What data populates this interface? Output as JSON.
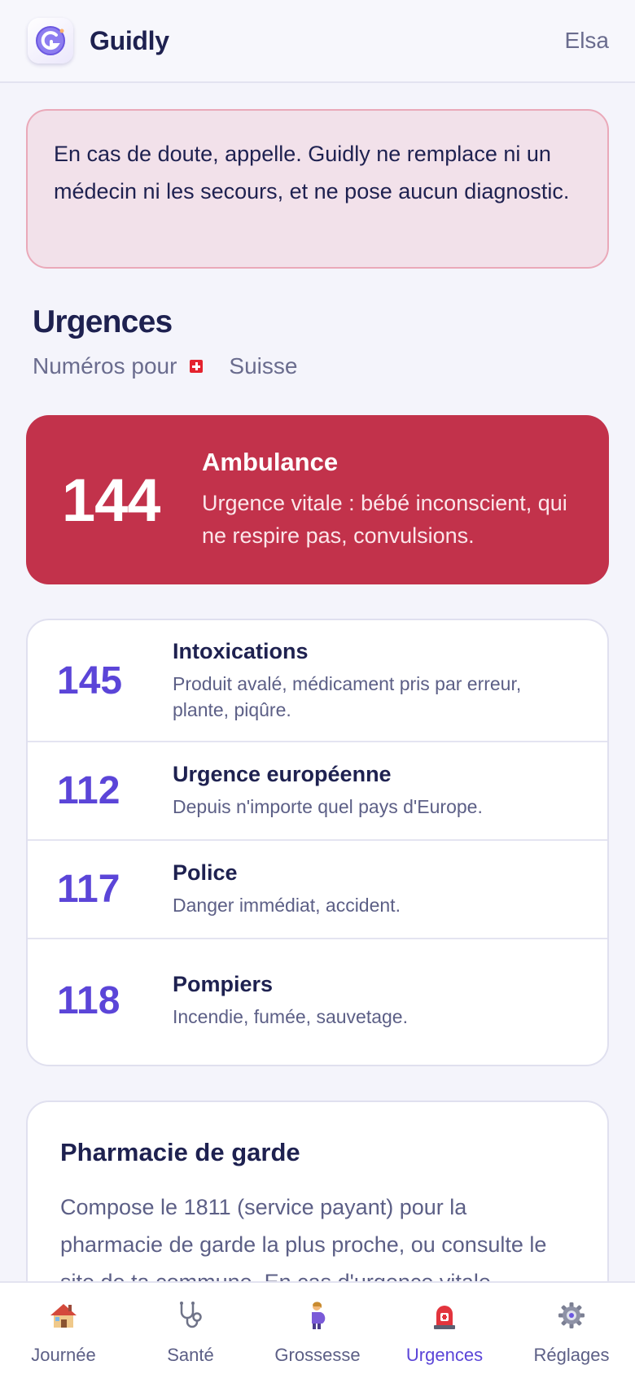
{
  "header": {
    "app_name": "Guidly",
    "user_name": "Elsa"
  },
  "warning": {
    "text": "En cas de doute, appelle. Guidly ne remplace ni un médecin ni les secours, et ne pose aucun diagnostic."
  },
  "section": {
    "title": "Urgences",
    "subtitle_prefix": "Numéros pour",
    "country": "Suisse"
  },
  "primary": {
    "number": "144",
    "title": "Ambulance",
    "description": "Urgence vitale : bébé inconscient, qui ne respire pas, convulsions."
  },
  "numbers": [
    {
      "number": "145",
      "title": "Intoxications",
      "description": "Produit avalé, médicament pris par erreur, plante, piqûre."
    },
    {
      "number": "112",
      "title": "Urgence européenne",
      "description": "Depuis n'importe quel pays d'Europe."
    },
    {
      "number": "117",
      "title": "Police",
      "description": "Danger immédiat, accident."
    },
    {
      "number": "118",
      "title": "Pompiers",
      "description": "Incendie, fumée, sauvetage."
    }
  ],
  "pharmacy": {
    "title": "Pharmacie de garde",
    "text": "Compose le 1811 (service payant) pour la pharmacie de garde la plus proche, ou consulte le site de ta commune. En cas d'urgence vitale"
  },
  "tabs": [
    {
      "label": "Journée",
      "icon": "house-icon"
    },
    {
      "label": "Santé",
      "icon": "stethoscope-icon"
    },
    {
      "label": "Grossesse",
      "icon": "pregnant-woman-icon"
    },
    {
      "label": "Urgences",
      "icon": "siren-icon",
      "active": true
    },
    {
      "label": "Réglages",
      "icon": "gear-icon"
    }
  ],
  "colors": {
    "accent": "#5b45d8",
    "emergency": "#c2324b",
    "warning_bg": "#f2e1ea",
    "warning_border": "#eaa9b9",
    "text_primary": "#1e2150",
    "text_secondary": "#5c5f86"
  }
}
